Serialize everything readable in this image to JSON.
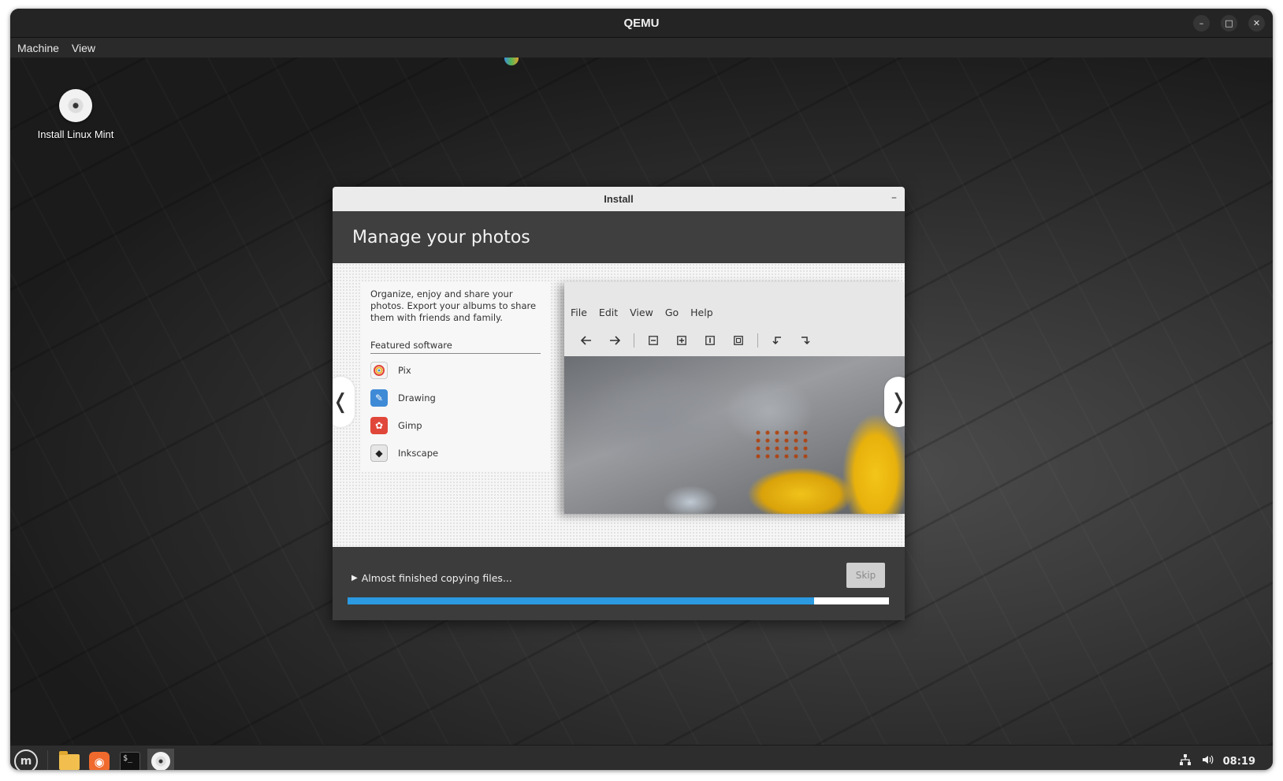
{
  "window": {
    "title": "QEMU",
    "controls": {
      "minimize": "–",
      "maximize": "□",
      "close": "✕"
    }
  },
  "menubar": {
    "items": [
      "Machine",
      "View"
    ]
  },
  "desktop": {
    "icon_label": "Install Linux Mint"
  },
  "installer": {
    "title": "Install",
    "minimize": "–",
    "heading": "Manage your photos",
    "slide": {
      "description": "Organize, enjoy and share your photos. Export your albums to share them with friends and family.",
      "featured_title": "Featured software",
      "apps": [
        {
          "label": "Pix",
          "icon": "pix-icon",
          "color": "#f4f4f4"
        },
        {
          "label": "Drawing",
          "icon": "drawing-icon",
          "color": "#3f8ad6"
        },
        {
          "label": "Gimp",
          "icon": "gimp-icon",
          "color": "#e0473a"
        },
        {
          "label": "Inkscape",
          "icon": "inkscape-icon",
          "color": "#e6e6e6"
        }
      ],
      "prev": "❬",
      "next": "❭",
      "screenshot": {
        "menu": [
          "File",
          "Edit",
          "View",
          "Go",
          "Help"
        ],
        "toolbar_icons": [
          "back-arrow-icon",
          "forward-arrow-icon",
          "zoom-out-icon",
          "zoom-in-icon",
          "zoom-original-icon",
          "zoom-fit-icon",
          "rotate-left-icon",
          "rotate-right-icon"
        ]
      }
    },
    "progress": {
      "status": "Almost finished copying files...",
      "fraction": 0.862,
      "skip_label": "Skip",
      "accent": "#2b9ae0"
    }
  },
  "taskbar": {
    "launchers": [
      "menu-icon",
      "files-icon",
      "firefox-icon",
      "terminal-icon",
      "installer-icon"
    ],
    "clock": "08:19"
  }
}
